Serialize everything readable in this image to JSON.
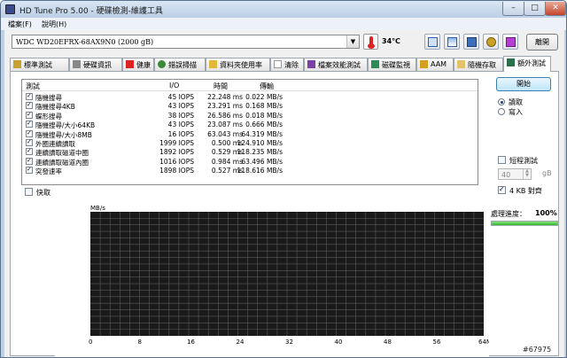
{
  "window": {
    "title": "HD Tune Pro  5.00 - 硬碟檢測-維護工具",
    "min_glyph": "–",
    "max_glyph": "□",
    "close_glyph": "✕"
  },
  "menu": [
    "檔案(F)",
    "說明(H)"
  ],
  "toolbar": {
    "drive": "WDC  WD20EFRX-68AX9N0 (2000 gB)",
    "drive_arrow": "▼",
    "temperature": "34℃",
    "exit_label": "離開",
    "icons": [
      "copy-text-icon",
      "copy-screenshot-icon",
      "save-icon",
      "options-icon",
      "download-icon"
    ]
  },
  "tabs": [
    "標準測試",
    "硬碟資訊",
    "健康",
    "錯誤掃描",
    "資料夾使用率",
    "清除",
    "檔案效能測試",
    "磁碟監視",
    "AAM",
    "隨機存取",
    "額外測試"
  ],
  "active_tab": 10,
  "results": {
    "headers": {
      "test": "測試",
      "io": "I/O",
      "time": "時間",
      "rate": "傳輸"
    },
    "rows": [
      {
        "name": "隨機搜尋",
        "io": "45 IOPS",
        "time": "22.248 ms",
        "rate": "0.022 MB/s"
      },
      {
        "name": "隨機搜尋4KB",
        "io": "43 IOPS",
        "time": "23.291 ms",
        "rate": "0.168 MB/s"
      },
      {
        "name": "蝶形搜尋",
        "io": "38 IOPS",
        "time": "26.586 ms",
        "rate": "0.018 MB/s"
      },
      {
        "name": "隨機搜尋/大小64KB",
        "io": "43 IOPS",
        "time": "23.087 ms",
        "rate": "0.666 MB/s"
      },
      {
        "name": "隨機搜尋/大小8MB",
        "io": "16 IOPS",
        "time": "63.043 ms",
        "rate": "64.319 MB/s"
      },
      {
        "name": "外圈連續讀取",
        "io": "1999 IOPS",
        "time": "0.500 ms",
        "rate": "124.910 MB/s"
      },
      {
        "name": "連續讀取磁道中圈",
        "io": "1892 IOPS",
        "time": "0.529 ms",
        "rate": "118.235 MB/s"
      },
      {
        "name": "連續讀取磁道內圈",
        "io": "1016 IOPS",
        "time": "0.984 ms",
        "rate": "63.496 MB/s"
      },
      {
        "name": "突發速率",
        "io": "1898 IOPS",
        "time": "0.527 ms",
        "rate": "118.616 MB/s"
      }
    ]
  },
  "options": {
    "quick_label": "快取",
    "start_label": "開始",
    "read_label": "讀取",
    "write_label": "寫入",
    "short_test_label": "短程測試",
    "short_test_value": "40",
    "short_test_unit": "gB",
    "align_label": "4 KB 對齊",
    "progress_label": "處理進度：",
    "progress_value": "100%",
    "progress_fraction": 1.0
  },
  "chart_data": {
    "type": "line",
    "ylabel": "MB/s",
    "xlabel_unit": "MB",
    "xticks": [
      "0",
      "8",
      "16",
      "24",
      "32",
      "40",
      "48",
      "56",
      "64MB"
    ],
    "x": [],
    "series": [],
    "grid": true,
    "background": "#1a1a1a",
    "grid_color": "#5a5a5a"
  },
  "watermark": "#67975"
}
